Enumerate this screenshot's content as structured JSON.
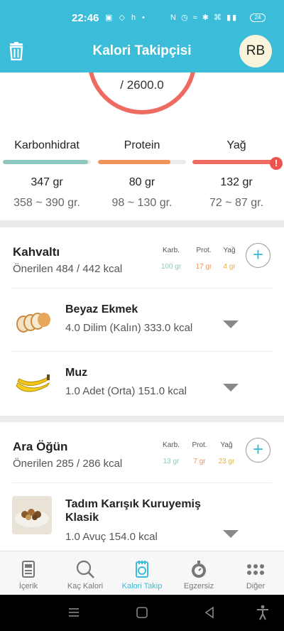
{
  "status": {
    "time": "22:46",
    "left_icons": "▣ ◇ h •",
    "right_icons": "N ◷ ≈ ✱ ⌘ ▮▮",
    "battery": "24"
  },
  "header": {
    "title": "Kalori Takipçisi",
    "avatar_initials": "RB"
  },
  "summary": {
    "calories_total": "/ 2600.0",
    "ring_color": "#ef6b61",
    "macros": [
      {
        "name": "Karbonhidrat",
        "amount": "347 gr",
        "range": "358 ~ 390 gr.",
        "progress": 0.97,
        "color": "#8ec9c1"
      },
      {
        "name": "Protein",
        "amount": "80 gr",
        "range": "98 ~ 130 gr.",
        "progress": 0.82,
        "color": "#f0945a"
      },
      {
        "name": "Yağ",
        "amount": "132 gr",
        "range": "72 ~ 87 gr.",
        "progress": 1.0,
        "color": "#ef6b61"
      }
    ],
    "warning": "!"
  },
  "meals": [
    {
      "title": "Kahvaltı",
      "subtitle": "Önerilen 484 / 442 kcal",
      "labels": {
        "carb": "Karb.",
        "prot": "Prot.",
        "fat": "Yağ"
      },
      "values": {
        "carb": "100 gr",
        "prot": "17 gr",
        "fat": "4 gr"
      },
      "add": "+",
      "items": [
        {
          "name": "Beyaz Ekmek",
          "desc": "4.0 Dilim (Kalın) 333.0 kcal",
          "icon": "bread-icon"
        },
        {
          "name": "Muz",
          "desc": "1.0 Adet (Orta) 151.0 kcal",
          "icon": "banana-icon"
        }
      ]
    },
    {
      "title": "Ara Öğün",
      "subtitle": "Önerilen 285 / 286 kcal",
      "labels": {
        "carb": "Karb.",
        "prot": "Prot.",
        "fat": "Yağ"
      },
      "values": {
        "carb": "13 gr",
        "prot": "7 gr",
        "fat": "23 gr"
      },
      "add": "+",
      "items": [
        {
          "name": "Tadım Karışık Kuruyemiş Klasik",
          "desc": "1.0 Avuç 154.0 kcal",
          "icon": "nuts-icon"
        }
      ]
    }
  ],
  "colors": {
    "accent": "#3bbcd8",
    "carb": "#8ec9c1",
    "prot": "#f0945a",
    "fat": "#e6b23a"
  },
  "tabs": [
    {
      "label": "İçerik",
      "icon": "content-icon"
    },
    {
      "label": "Kaç Kalori",
      "icon": "search-icon"
    },
    {
      "label": "Kalori Takip",
      "icon": "tracker-icon",
      "active": true
    },
    {
      "label": "Egzersiz",
      "icon": "stopwatch-icon"
    },
    {
      "label": "Diğer",
      "icon": "more-icon"
    }
  ]
}
